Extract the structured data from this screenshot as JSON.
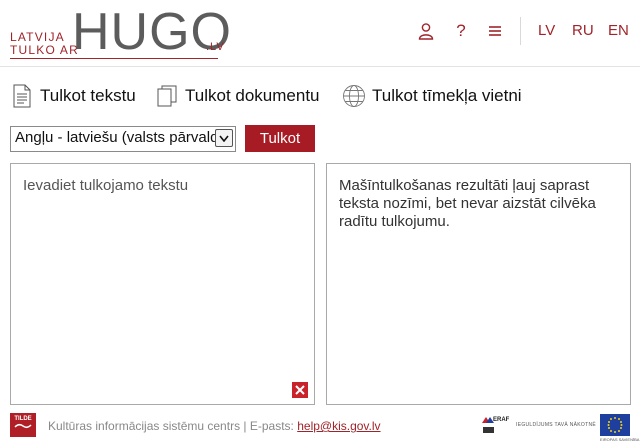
{
  "header": {
    "logo": {
      "line1": "LATVIJA",
      "line2": "TULKO AR",
      "brand": "HUGO",
      "tld": ".LV"
    },
    "icons": [
      "user-icon",
      "help-icon",
      "menu-icon"
    ],
    "help_glyph": "?",
    "languages": [
      "LV",
      "RU",
      "EN"
    ]
  },
  "tabs": [
    {
      "label": "Tulkot tekstu",
      "icon": "text-document-icon"
    },
    {
      "label": "Tulkot dokumentu",
      "icon": "documents-icon"
    },
    {
      "label": "Tulkot tīmekļa vietni",
      "icon": "globe-icon"
    }
  ],
  "controls": {
    "language_pair": "Angļu - latviešu (valsts pārvalde)",
    "translate_label": "Tulkot"
  },
  "source": {
    "placeholder": "Ievadiet tulkojamo tekstu"
  },
  "output": {
    "text": "Mašīntulkošanas rezultāti ļauj saprast teksta nozīmi, bet nevar aizstāt cilvēka radītu tulkojumu."
  },
  "footer": {
    "org_text": "Kultūras informācijas sistēmu centrs | E-pasts:",
    "email": "help@kis.gov.lv",
    "tilde_label": "TILDE",
    "eraf_label": "ERAF",
    "eu_slogan": "IEGULDĪJUMS TAVĀ NĀKOTNĒ",
    "eu_caption": "EIROPAS SAVIENĪBA"
  },
  "colors": {
    "accent": "#a71c24",
    "border": "#a9a9a9"
  }
}
